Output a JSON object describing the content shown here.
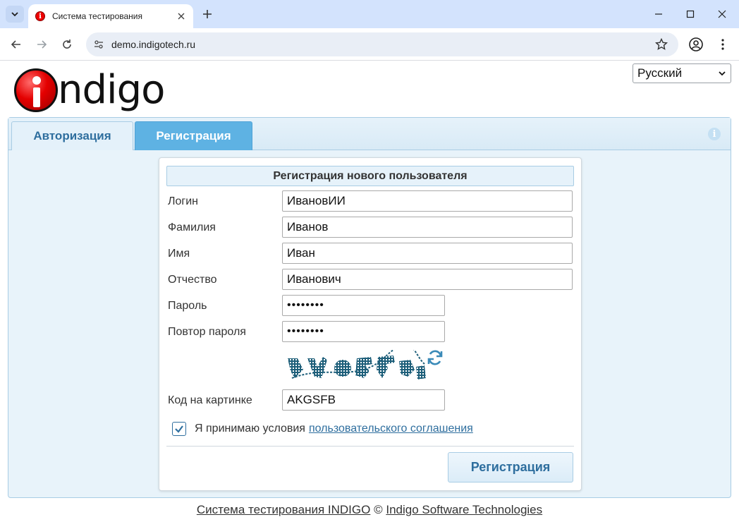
{
  "browser": {
    "tab_title": "Система тестирования",
    "url": "demo.indigotech.ru",
    "favicon_letter": "i"
  },
  "logo": {
    "text": "ndigo"
  },
  "language": {
    "selected": "Русский"
  },
  "tabs": [
    {
      "label": "Авторизация",
      "active": false
    },
    {
      "label": "Регистрация",
      "active": true
    }
  ],
  "form": {
    "title": "Регистрация нового пользователя",
    "fields": {
      "login": {
        "label": "Логин",
        "value": "ИвановИИ"
      },
      "last_name": {
        "label": "Фамилия",
        "value": "Иванов"
      },
      "first_name": {
        "label": "Имя",
        "value": "Иван"
      },
      "patronymic": {
        "label": "Отчество",
        "value": "Иванович"
      },
      "password": {
        "label": "Пароль",
        "value": "••••••••"
      },
      "password_repeat": {
        "label": "Повтор пароля",
        "value": "••••••••"
      },
      "captcha_code": {
        "label": "Код на картинке",
        "value": "AKGSFB"
      }
    },
    "agree_text": "Я принимаю условия",
    "agree_link": "пользовательского соглашения",
    "agree_checked": true,
    "submit_label": "Регистрация"
  },
  "footer": {
    "system_link": "Система тестирования INDIGO",
    "copyright": "©",
    "company_link": "Indigo Software Technologies"
  },
  "colors": {
    "accent": "#2e6e9e",
    "active_tab": "#5eb2e3",
    "panel_bg": "#e8f3fa",
    "chrome_bg": "#d3e3fd"
  }
}
